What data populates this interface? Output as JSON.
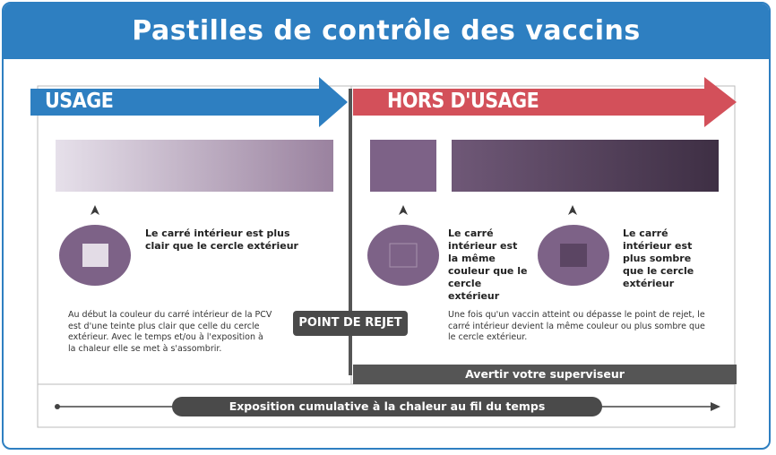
{
  "title": "Pastilles de contrôle des vaccins",
  "usage": {
    "label": "USAGE",
    "description": "Le carré intérieur est plus clair que le cercle extérieur",
    "note": "Au début la couleur du carré intérieur de la PCV est d'une teinte plus clair que celle du cercle extérieur. Avec le temps et/ou à l'exposition à la chaleur elle se met à s'assombrir."
  },
  "discard": {
    "label": "HORS D'USAGE",
    "same_description": "Le carré intérieur est la même couleur que le cercle extérieur",
    "dark_description": "Le carré intérieur est plus sombre que le cercle extérieur",
    "note": "Une fois qu'un vaccin atteint ou dépasse le point de rejet, le carré intérieur devient la même couleur ou plus sombre que le cercle extérieur.",
    "alert": "Avertir votre superviseur"
  },
  "reject_point": "POINT DE REJET",
  "timeline": "Exposition cumulative à la chaleur au fil du temps",
  "colors": {
    "blue": "#2e7fc1",
    "red": "#d3505a",
    "circle": "#7d6287",
    "usage_square": "#e3dce6",
    "same_square": "#7d6287",
    "dark_square": "#5b4563"
  }
}
